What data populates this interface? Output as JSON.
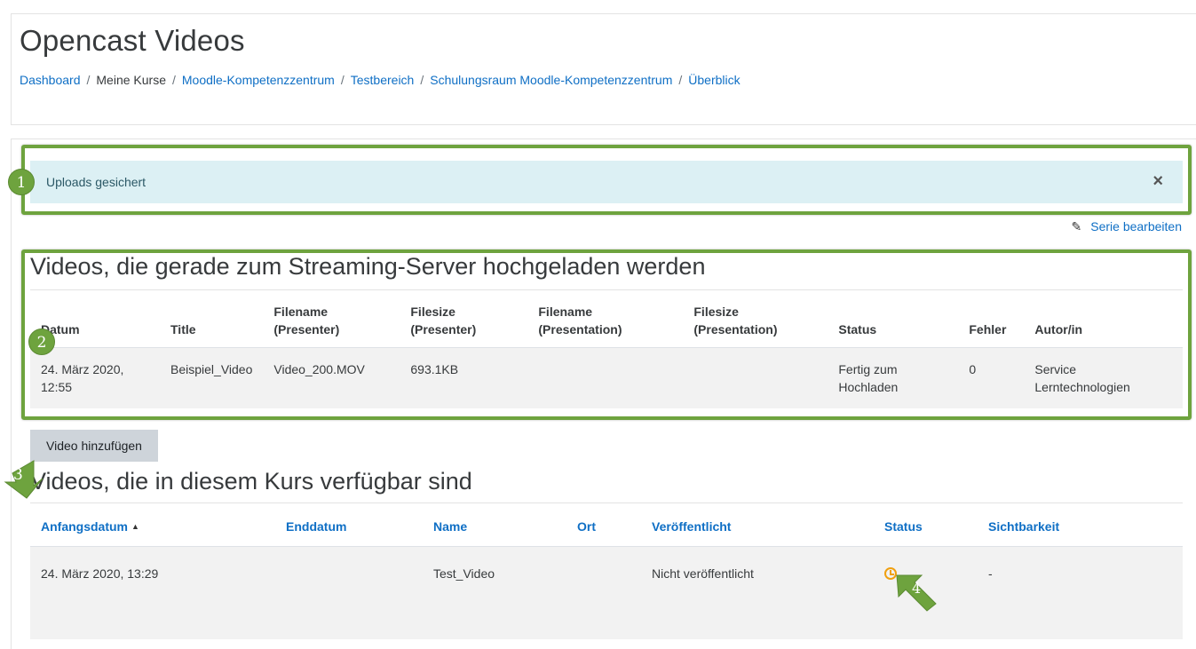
{
  "page_title": "Opencast Videos",
  "breadcrumb": [
    {
      "label": "Dashboard",
      "link": true
    },
    {
      "label": "Meine Kurse",
      "link": false
    },
    {
      "label": "Moodle-Kompetenzzentrum",
      "link": true
    },
    {
      "label": "Testbereich",
      "link": true
    },
    {
      "label": "Schulungsraum Moodle-Kompetenzzentrum",
      "link": true
    },
    {
      "label": "Überblick",
      "link": true
    }
  ],
  "breadcrumb_separator": "/",
  "alert": {
    "text": "Uploads gesichert",
    "close_symbol": "×"
  },
  "series_edit_link": "Serie bearbeiten",
  "uploads_section": {
    "heading": "Videos, die gerade zum Streaming-Server hochgeladen werden",
    "columns": [
      "Datum",
      "Title",
      "Filename (Presenter)",
      "Filesize (Presenter)",
      "Filename (Presentation)",
      "Filesize (Presentation)",
      "Status",
      "Fehler",
      "Autor/in"
    ],
    "rows": [
      [
        "24. März 2020, 12:55",
        "Beispiel_Video",
        "Video_200.MOV",
        "693.1KB",
        "",
        "",
        "Fertig zum Hochladen",
        "0",
        "Service Lerntechnologien"
      ]
    ]
  },
  "add_video_button": "Video hinzufügen",
  "course_section": {
    "heading": "Videos, die in diesem Kurs verfügbar sind",
    "columns": [
      "Anfangsdatum",
      "Enddatum",
      "Name",
      "Ort",
      "Veröffentlicht",
      "Status",
      "Sichtbarkeit"
    ],
    "rows": [
      {
        "start": "24. März 2020, 13:29",
        "end": "",
        "name": "Test_Video",
        "location": "",
        "published": "Nicht veröffentlicht",
        "status_icon": "clock-icon",
        "visibility": "-"
      }
    ]
  },
  "markers": [
    "1",
    "2",
    "3",
    "4"
  ],
  "colors": {
    "accent": "#6ea33e",
    "link": "#0f6fc5",
    "alert_bg": "#dcf0f4",
    "row_bg": "#f2f2f2",
    "clock": "#f0a010"
  }
}
